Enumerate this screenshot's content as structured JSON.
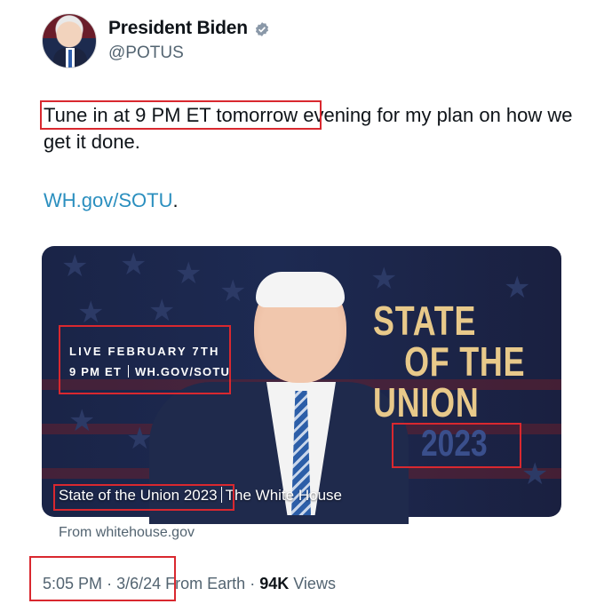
{
  "author": {
    "name": "President Biden",
    "handle": "@POTUS"
  },
  "tweet": {
    "text_part1": "Tune in at 9 PM ET tomorrow",
    "text_part2": " evening for my plan on how we get it done.",
    "link": "WH.gov/SOTU",
    "link_suffix": "."
  },
  "card": {
    "live_line1": "LIVE FEBRUARY 7TH",
    "live_time": "9 PM ET",
    "live_site": "WH.GOV/SOTU",
    "title_line1": "STATE",
    "title_line2": "OF THE",
    "title_line3": "UNION",
    "year": "2023",
    "caption_title": "State of the Union 2023",
    "caption_source": "The White House",
    "from_text": "From whitehouse.gov"
  },
  "meta": {
    "time": "5:05 PM",
    "separator": "·",
    "date": "3/6/24",
    "location": "From Earth",
    "views_count": "94K",
    "views_label": "Views"
  },
  "colors": {
    "highlight": "#d9282f",
    "link": "#2b8fbf",
    "card_bg": "#1d2a52",
    "title_gold": "#e8c98a"
  }
}
